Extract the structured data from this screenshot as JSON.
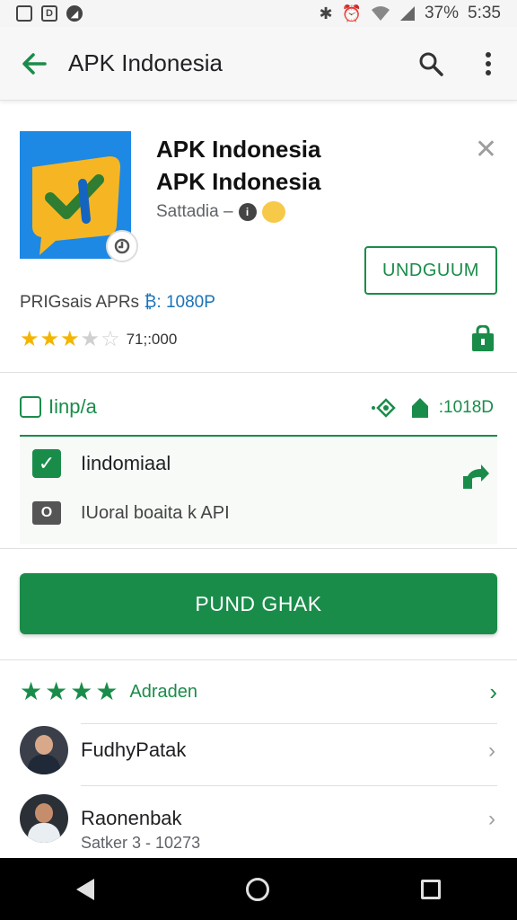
{
  "status_bar": {
    "battery": "37%",
    "time": "5:35",
    "left_icons": [
      "photo-icon",
      "d-icon",
      "notification-icon"
    ],
    "right_icons": [
      "bluetooth-icon",
      "alarm-icon",
      "wifi-icon",
      "signal-icon"
    ]
  },
  "appbar": {
    "title": "APK Indonesia"
  },
  "app": {
    "name_line1": "APK Indonesia",
    "name_line2": "APK Indonesia",
    "developer": "Sattadia –",
    "install_label": "UNDGUUM",
    "meta_text": "PRIGsais APRs",
    "meta_accent": "₿: 1080P",
    "rating_stars": 3,
    "rating_max": 5,
    "rating_count": "71;:000"
  },
  "info_row": {
    "left_label": "Iinp/a",
    "right_label": ":1018D"
  },
  "options": {
    "option1": "Iindomiaal",
    "option2_badge": "O",
    "option2": "IUoral boaita k API"
  },
  "primary_button": {
    "label": "PUND GHAK"
  },
  "reviews": {
    "stars": 4,
    "label": "Adraden",
    "items": [
      {
        "name": "FudhyPatak",
        "sub": ""
      },
      {
        "name": "Raonenbak",
        "sub": "Satker 3 - 10273"
      }
    ]
  },
  "colors": {
    "accent_green": "#1a8c4a",
    "star_yellow": "#f4b400",
    "link_blue": "#1a73b8"
  }
}
